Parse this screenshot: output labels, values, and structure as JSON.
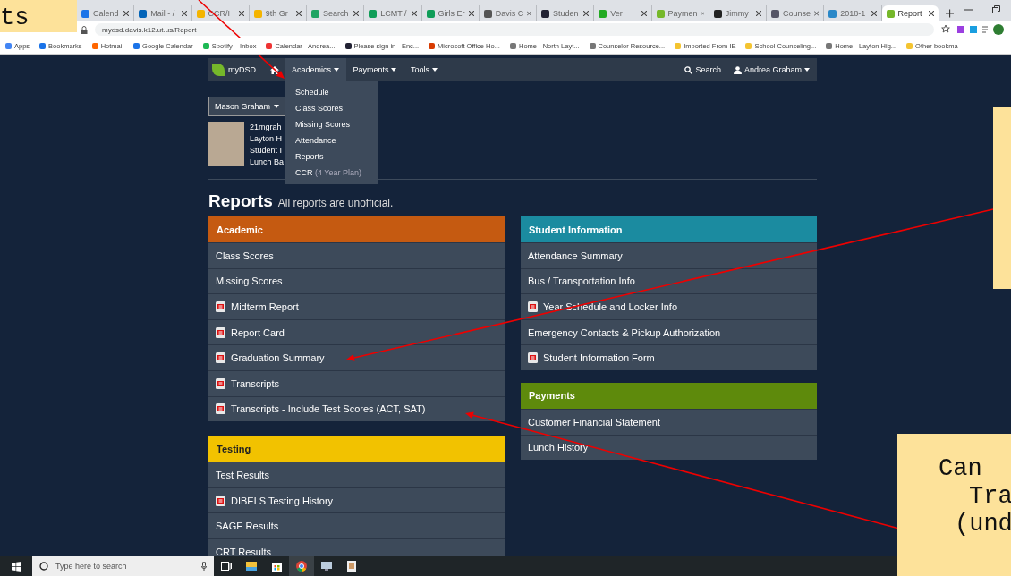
{
  "browser": {
    "tabs": [
      {
        "label": "Calend",
        "selected": false
      },
      {
        "label": "Mail - /",
        "selected": false
      },
      {
        "label": "CCR/I",
        "selected": false
      },
      {
        "label": "9th Gr",
        "selected": false
      },
      {
        "label": "Search",
        "selected": false
      },
      {
        "label": "LCMT /",
        "selected": false
      },
      {
        "label": "Girls Er",
        "selected": false
      },
      {
        "label": "Davis C",
        "selected": false
      },
      {
        "label": "Studen",
        "selected": false
      },
      {
        "label": "Ver",
        "selected": false
      },
      {
        "label": "Paymen",
        "selected": false
      },
      {
        "label": "Jimmy",
        "selected": false
      },
      {
        "label": "Counse",
        "selected": false
      },
      {
        "label": "2018-1",
        "selected": false
      },
      {
        "label": "Report",
        "selected": true
      }
    ],
    "url": "mydsd.davis.k12.ut.us/Report",
    "bookmarks": [
      "Apps",
      "Bookmarks",
      "Hotmail",
      "Google Calendar",
      "Spotify – Inbox",
      "Calendar - Andrea...",
      "Please sign in - Enc...",
      "Microsoft Office Ho...",
      "Home - North Layt...",
      "Counselor Resource...",
      "Imported From IE",
      "School Counseling...",
      "Home - Layton Hig...",
      "Other bookma"
    ]
  },
  "nav": {
    "logo": "myDSD",
    "menus": [
      {
        "label": "Academics",
        "expanded": true
      },
      {
        "label": "Payments",
        "expanded": false
      },
      {
        "label": "Tools",
        "expanded": false
      }
    ],
    "search": "Search",
    "user": "Andrea Graham"
  },
  "dropdown": [
    {
      "label": "Schedule"
    },
    {
      "label": "Class Scores"
    },
    {
      "label": "Missing Scores"
    },
    {
      "label": "Attendance"
    },
    {
      "label": "Reports"
    },
    {
      "label": "CCR",
      "note": "(4 Year Plan)"
    }
  ],
  "student": {
    "name": "Mason Graham",
    "lines": [
      "21mgrah",
      "Layton H",
      "Student I",
      "Lunch Ba"
    ]
  },
  "heading": {
    "title": "Reports",
    "subtitle": "All reports are unofficial."
  },
  "columns": [
    [
      {
        "title": "Academic",
        "color": "#c55a11",
        "items": [
          {
            "label": "Class Scores",
            "pdf": false
          },
          {
            "label": "Missing Scores",
            "pdf": false
          },
          {
            "label": "Midterm Report",
            "pdf": true
          },
          {
            "label": "Report Card",
            "pdf": true
          },
          {
            "label": "Graduation Summary",
            "pdf": true
          },
          {
            "label": "Transcripts",
            "pdf": true
          },
          {
            "label": "Transcripts - Include Test Scores (ACT, SAT)",
            "pdf": true
          }
        ]
      },
      {
        "title": "Testing",
        "color": "#f2c200",
        "items": [
          {
            "label": "Test Results",
            "pdf": false
          },
          {
            "label": "DIBELS Testing History",
            "pdf": true
          },
          {
            "label": "SAGE Results",
            "pdf": false
          },
          {
            "label": "CRT Results",
            "pdf": false
          }
        ]
      }
    ],
    [
      {
        "title": "Student Information",
        "color": "#1b8ba0",
        "items": [
          {
            "label": "Attendance Summary",
            "pdf": false
          },
          {
            "label": "Bus / Transportation Info",
            "pdf": false
          },
          {
            "label": "Year Schedule and Locker Info",
            "pdf": true
          },
          {
            "label": "Emergency Contacts & Pickup Authorization",
            "pdf": false
          },
          {
            "label": "Student Information Form",
            "pdf": true
          }
        ]
      },
      {
        "title": "Payments",
        "color": "#5e8a0c",
        "items": [
          {
            "label": "Customer Financial Statement",
            "pdf": false
          },
          {
            "label": "Lunch History",
            "pdf": false
          }
        ]
      }
    ]
  ],
  "annotations": [
    {
      "lines": [
        "ts"
      ]
    },
    {
      "lines": [
        "Can",
        "Tra",
        "(und"
      ]
    }
  ],
  "taskbar": {
    "search_placeholder": "Type here to search"
  }
}
